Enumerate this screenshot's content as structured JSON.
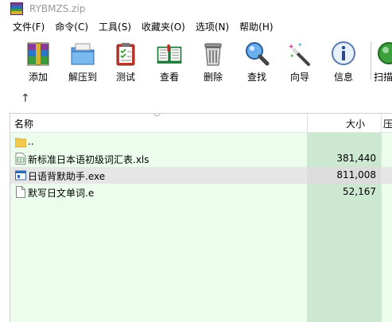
{
  "window": {
    "title": "RYBMZS.zip"
  },
  "menu": [
    {
      "label": "文件(F)"
    },
    {
      "label": "命令(C)"
    },
    {
      "label": "工具(S)"
    },
    {
      "label": "收藏夹(O)"
    },
    {
      "label": "选项(N)"
    },
    {
      "label": "帮助(H)"
    }
  ],
  "toolbar": [
    {
      "label": "添加",
      "icon": "add-archive-icon"
    },
    {
      "label": "解压到",
      "icon": "extract-folder-icon"
    },
    {
      "label": "测试",
      "icon": "test-clipboard-icon"
    },
    {
      "label": "查看",
      "icon": "view-book-icon"
    },
    {
      "label": "删除",
      "icon": "trash-icon"
    },
    {
      "label": "查找",
      "icon": "magnifier-icon"
    },
    {
      "label": "向导",
      "icon": "wizard-wand-icon"
    },
    {
      "label": "信息",
      "icon": "info-icon"
    },
    {
      "label": "扫描",
      "icon": "scan-icon"
    }
  ],
  "nav": {
    "up": "↑"
  },
  "list": {
    "columns": {
      "name": "名称",
      "size": "大小",
      "packed": "压"
    },
    "rows": [
      {
        "name": "..",
        "size": "",
        "type": "parent-folder"
      },
      {
        "name": "新标准日本语初级词汇表.xls",
        "size": "381,440",
        "type": "xls"
      },
      {
        "name": "日语背默助手.exe",
        "size": "811,008",
        "type": "exe"
      },
      {
        "name": "默写日文单词.e",
        "size": "52,167",
        "type": "file"
      }
    ]
  },
  "colors": {
    "list_bg": "#ecfded",
    "size_col_bg": "#cde8d0",
    "selected_row": "#e6e6e6"
  }
}
